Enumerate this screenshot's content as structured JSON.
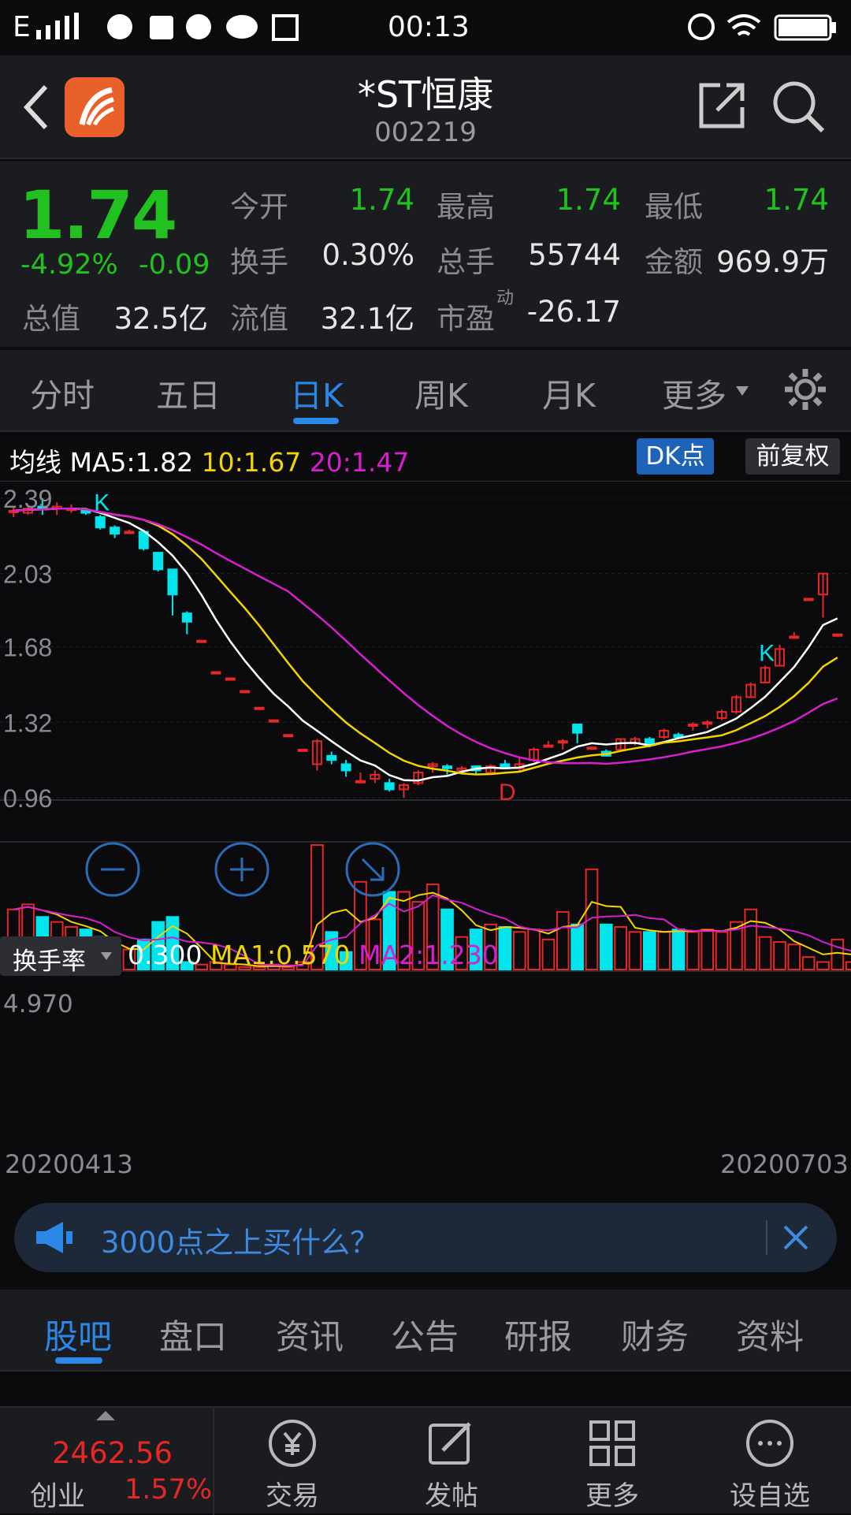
{
  "status_bar": {
    "carrier": "E",
    "time": "00:13"
  },
  "header": {
    "title": "*ST恒康",
    "code": "002219"
  },
  "quote": {
    "price": "1.74",
    "change_pct": "-4.92%",
    "change": "-0.09",
    "rows": [
      [
        {
          "label": "今开",
          "value": "1.74",
          "color": "green"
        },
        {
          "label": "最高",
          "value": "1.74",
          "color": "green"
        },
        {
          "label": "最低",
          "value": "1.74",
          "color": "green"
        }
      ],
      [
        {
          "label": "换手",
          "value": "0.30%",
          "color": "white"
        },
        {
          "label": "总手",
          "value": "55744",
          "color": "white"
        },
        {
          "label": "金额",
          "value": "969.9万",
          "color": "white"
        }
      ],
      [
        {
          "label": "流值",
          "value": "32.1亿",
          "color": "white"
        },
        {
          "label": "市盈",
          "value": "-26.17",
          "color": "white",
          "sup": "动"
        }
      ]
    ],
    "total_value_label": "总值",
    "total_value": "32.5亿",
    "more_button": "更多"
  },
  "period_tabs": [
    "分时",
    "五日",
    "日K",
    "周K",
    "月K",
    "更多"
  ],
  "active_period_index": 2,
  "ma_legend": {
    "label": "均线",
    "ma5": "MA5:1.82",
    "ma10": "10:1.67",
    "ma20": "20:1.47"
  },
  "chart_buttons": {
    "dk": "DK点",
    "fq": "前复权"
  },
  "indicator": {
    "name": "换手率",
    "value": "0.300",
    "ma1": "MA1:0.570",
    "ma2": "MA2:1.230"
  },
  "chart_data": {
    "type": "candlestick",
    "y_ticks": [
      "2.39",
      "2.03",
      "1.68",
      "1.32",
      "0.96"
    ],
    "ylim": [
      0.96,
      2.39
    ],
    "vol_max_label": "4.970",
    "x_start": "20200413",
    "x_end": "20200703",
    "markers": [
      {
        "text": "K",
        "i": 6
      },
      {
        "text": "D",
        "i": 34
      },
      {
        "text": "K",
        "i": 52
      }
    ],
    "candles": [
      [
        2.33,
        2.33,
        2.3,
        2.35
      ],
      [
        2.32,
        2.34,
        2.31,
        2.36
      ],
      [
        2.35,
        2.34,
        2.31,
        2.39
      ],
      [
        2.34,
        2.35,
        2.31,
        2.37
      ],
      [
        2.34,
        2.34,
        2.32,
        2.36
      ],
      [
        2.33,
        2.32,
        2.31,
        2.34
      ],
      [
        2.3,
        2.25,
        2.24,
        2.31
      ],
      [
        2.25,
        2.22,
        2.2,
        2.26
      ],
      [
        2.23,
        2.23,
        2.22,
        2.24
      ],
      [
        2.23,
        2.15,
        2.14,
        2.24
      ],
      [
        2.13,
        2.05,
        2.04,
        2.13
      ],
      [
        2.05,
        1.93,
        1.83,
        2.05
      ],
      [
        1.84,
        1.8,
        1.74,
        1.85
      ],
      [
        1.71,
        1.71,
        1.71,
        1.71
      ],
      [
        1.56,
        1.56,
        1.56,
        1.56
      ],
      [
        1.53,
        1.53,
        1.53,
        1.53
      ],
      [
        1.47,
        1.47,
        1.47,
        1.47
      ],
      [
        1.39,
        1.39,
        1.39,
        1.39
      ],
      [
        1.33,
        1.33,
        1.33,
        1.33
      ],
      [
        1.26,
        1.26,
        1.26,
        1.26
      ],
      [
        1.19,
        1.19,
        1.19,
        1.19
      ],
      [
        1.12,
        1.23,
        1.09,
        1.24
      ],
      [
        1.16,
        1.14,
        1.12,
        1.18
      ],
      [
        1.12,
        1.09,
        1.06,
        1.14
      ],
      [
        1.04,
        1.04,
        1.03,
        1.08
      ],
      [
        1.05,
        1.07,
        1.03,
        1.09
      ],
      [
        1.03,
        1.0,
        0.99,
        1.05
      ],
      [
        1.0,
        1.02,
        0.96,
        1.03
      ],
      [
        1.03,
        1.08,
        1.02,
        1.09
      ],
      [
        1.11,
        1.12,
        1.08,
        1.13
      ],
      [
        1.11,
        1.1,
        1.07,
        1.12
      ],
      [
        1.09,
        1.1,
        1.08,
        1.11
      ],
      [
        1.11,
        1.09,
        1.07,
        1.11
      ],
      [
        1.08,
        1.11,
        1.07,
        1.12
      ],
      [
        1.12,
        1.1,
        1.1,
        1.14
      ],
      [
        1.1,
        1.12,
        1.08,
        1.15
      ],
      [
        1.14,
        1.19,
        1.13,
        1.2
      ],
      [
        1.21,
        1.21,
        1.2,
        1.23
      ],
      [
        1.23,
        1.23,
        1.19,
        1.24
      ],
      [
        1.31,
        1.27,
        1.22,
        1.31
      ],
      [
        1.2,
        1.2,
        1.2,
        1.2
      ],
      [
        1.18,
        1.16,
        1.16,
        1.19
      ],
      [
        1.19,
        1.24,
        1.19,
        1.24
      ],
      [
        1.22,
        1.24,
        1.21,
        1.25
      ],
      [
        1.24,
        1.21,
        1.2,
        1.25
      ],
      [
        1.25,
        1.28,
        1.24,
        1.29
      ],
      [
        1.26,
        1.25,
        1.24,
        1.27
      ],
      [
        1.31,
        1.31,
        1.28,
        1.32
      ],
      [
        1.32,
        1.32,
        1.29,
        1.33
      ],
      [
        1.34,
        1.37,
        1.33,
        1.38
      ],
      [
        1.37,
        1.44,
        1.36,
        1.45
      ],
      [
        1.44,
        1.5,
        1.44,
        1.51
      ],
      [
        1.51,
        1.58,
        1.51,
        1.59
      ],
      [
        1.59,
        1.67,
        1.59,
        1.69
      ],
      [
        1.73,
        1.73,
        1.73,
        1.75
      ],
      [
        1.91,
        1.91,
        1.91,
        1.91
      ],
      [
        1.93,
        2.03,
        1.82,
        2.03
      ],
      [
        1.74,
        1.74,
        1.74,
        1.74
      ]
    ],
    "turnover": [
      2.4,
      2.6,
      2.1,
      1.9,
      1.7,
      1.6,
      1.3,
      0.4,
      0.8,
      1.2,
      1.9,
      2.1,
      0.3,
      0.2,
      0.3,
      0.2,
      0.1,
      0.1,
      0.2,
      0.1,
      0.3,
      4.97,
      1.5,
      0.7,
      3.5,
      2.0,
      3.1,
      3.1,
      2.7,
      3.4,
      2.4,
      1.3,
      1.6,
      1.8,
      1.7,
      1.5,
      1.6,
      1.2,
      2.3,
      1.8,
      4.0,
      1.8,
      1.7,
      1.5,
      1.5,
      1.5,
      1.6,
      1.5,
      1.6,
      1.5,
      1.9,
      2.4,
      1.3,
      1.1,
      1.0,
      0.5,
      0.3,
      1.2,
      0.3
    ]
  },
  "news_banner": "3000点之上买什么？",
  "sub_tabs": [
    "股吧",
    "盘口",
    "资讯",
    "公告",
    "研报",
    "财务",
    "资料"
  ],
  "active_sub_tab_index": 0,
  "bottom_bar": {
    "index_value": "2462.56",
    "index_name": "创业",
    "index_change": "1.57%",
    "items": [
      "交易",
      "发帖",
      "更多",
      "设自选"
    ]
  },
  "colors": {
    "up": "#e62727",
    "down": "#00e5ec",
    "ma5": "#ffffff",
    "ma10": "#f2d500",
    "ma20": "#d81fd0",
    "accent": "#2b87e8",
    "green": "#21c21f"
  }
}
